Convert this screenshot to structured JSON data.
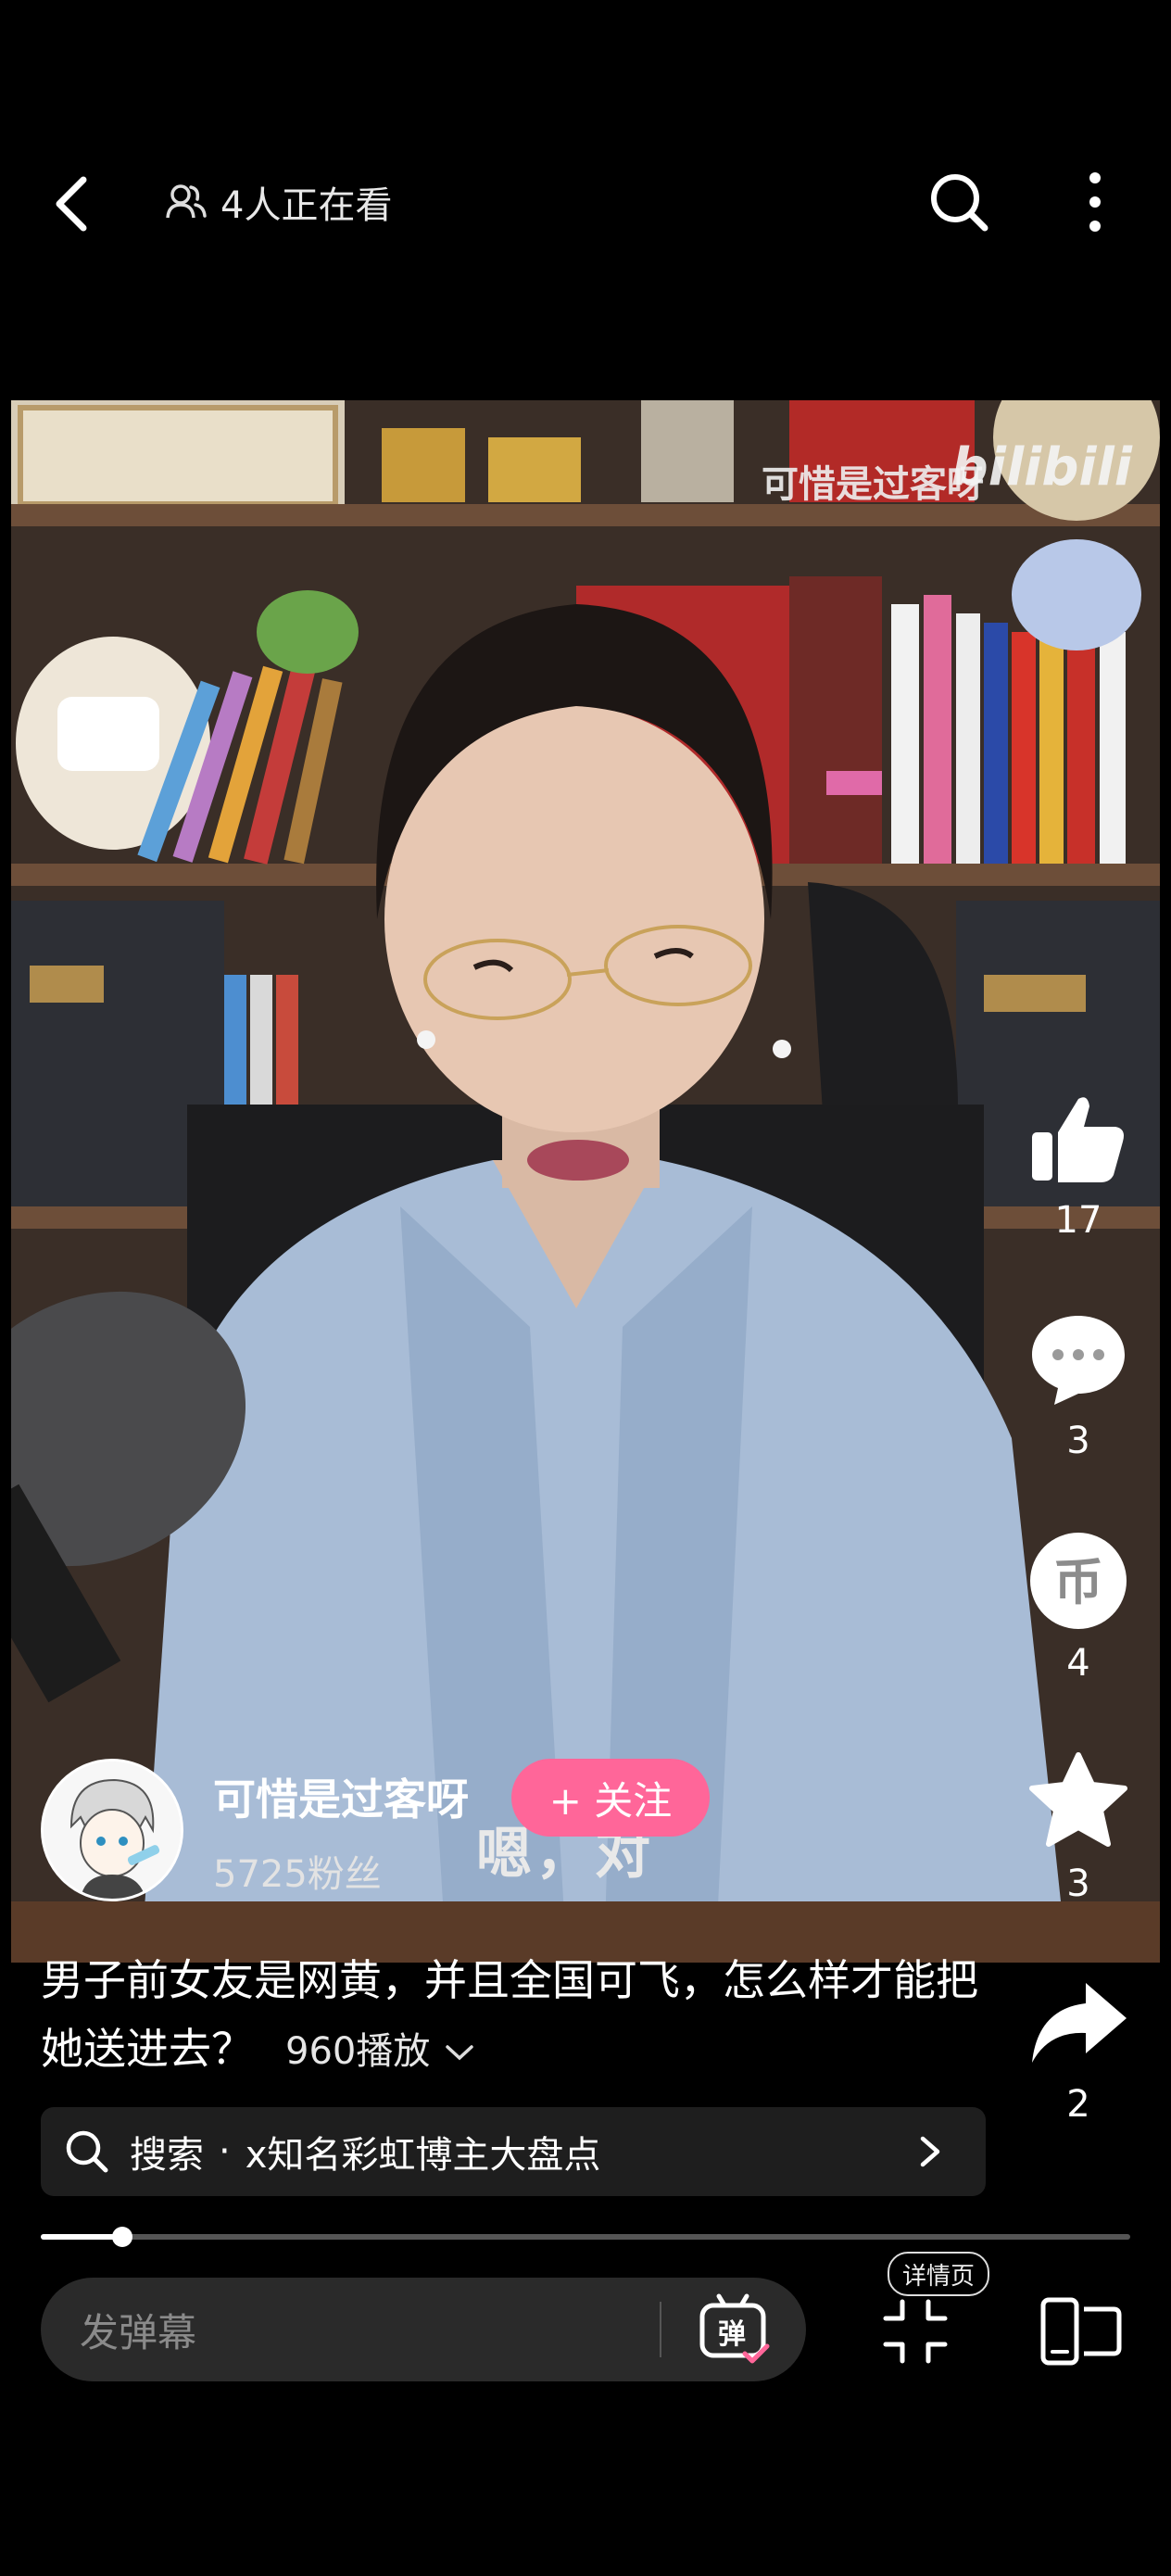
{
  "top_bar": {
    "viewers_text": "4人正在看",
    "icons": [
      "back-arrow-icon",
      "people-icon",
      "search-icon",
      "more-vertical-icon"
    ]
  },
  "video": {
    "watermark_text": "可惜是过客呀",
    "logo_text": "bilibili",
    "caption_text": "嗯，对"
  },
  "actions": {
    "like_count": "17",
    "comment_count": "3",
    "coin_count": "4",
    "favorite_count": "3",
    "share_count": "2"
  },
  "author": {
    "name": "可惜是过客呀",
    "fans": "5725粉丝",
    "follow_label": "+ 关注"
  },
  "post": {
    "title": "男子前女友是网黄，并且全国可飞，怎么样才能把她送进去？",
    "plays": "960播放"
  },
  "search": {
    "prefix": "搜索",
    "dot": "·",
    "query": "x知名彩虹博主大盘点"
  },
  "progress": {
    "fraction": 0.075
  },
  "bottom_bar": {
    "danmaku_placeholder": "发弹幕",
    "danmaku_toggle_glyph": "弹",
    "detail_badge": "详情页"
  },
  "colors": {
    "accent": "#ff6699",
    "background": "#000000"
  }
}
